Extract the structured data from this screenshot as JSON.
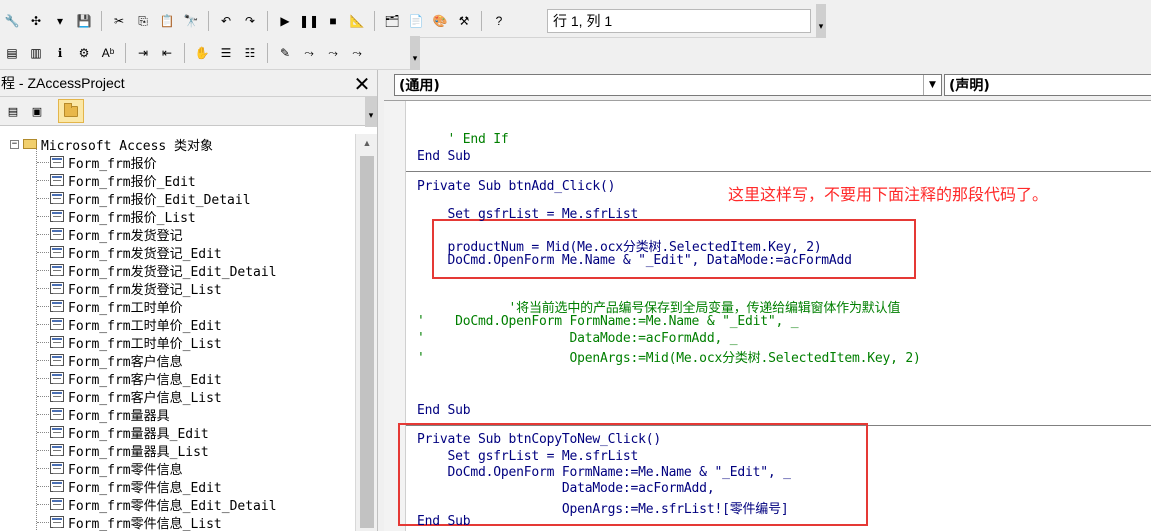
{
  "toolbar1": {
    "buttons": [
      {
        "icon": "tools-icon",
        "glyph": "🔧"
      },
      {
        "icon": "insert-icon",
        "glyph": "✣"
      },
      {
        "icon": "dropdown-arrow-icon",
        "glyph": "▾"
      },
      {
        "icon": "save-icon",
        "glyph": "💾"
      },
      {
        "icon": "cut-icon",
        "glyph": "✂"
      },
      {
        "icon": "copy-icon",
        "glyph": "⎘"
      },
      {
        "icon": "paste-icon",
        "glyph": "📋"
      },
      {
        "icon": "find-icon",
        "glyph": "🔭"
      },
      {
        "icon": "undo-icon",
        "glyph": "↶"
      },
      {
        "icon": "redo-icon",
        "glyph": "↷"
      },
      {
        "icon": "run-icon",
        "glyph": "▶"
      },
      {
        "icon": "break-icon",
        "glyph": "❚❚"
      },
      {
        "icon": "reset-icon",
        "glyph": "■"
      },
      {
        "icon": "design-mode-icon",
        "glyph": "📐"
      },
      {
        "icon": "project-explorer-icon",
        "glyph": "🗂"
      },
      {
        "icon": "properties-icon",
        "glyph": "📄"
      },
      {
        "icon": "object-browser-icon",
        "glyph": "🎨"
      },
      {
        "icon": "toolbox-icon",
        "glyph": "⚒"
      },
      {
        "icon": "help-icon",
        "glyph": "?"
      }
    ],
    "position_text": "行 1, 列 1"
  },
  "toolbar2": {
    "buttons": [
      {
        "icon": "list-properties-icon",
        "glyph": "▤"
      },
      {
        "icon": "list-constants-icon",
        "glyph": "▥"
      },
      {
        "icon": "quick-info-icon",
        "glyph": "ℹ"
      },
      {
        "icon": "parameter-info-icon",
        "glyph": "⚙"
      },
      {
        "icon": "complete-word-icon",
        "glyph": "Aᵇ"
      },
      {
        "icon": "indent-icon",
        "glyph": "⇥"
      },
      {
        "icon": "outdent-icon",
        "glyph": "⇤"
      },
      {
        "icon": "toggle-breakpoint-icon",
        "glyph": "✋"
      },
      {
        "icon": "comment-block-icon",
        "glyph": "☰"
      },
      {
        "icon": "uncomment-block-icon",
        "glyph": "☷"
      },
      {
        "icon": "toggle-bookmark-icon",
        "glyph": "✎"
      },
      {
        "icon": "next-bookmark-icon",
        "glyph": "⤳"
      },
      {
        "icon": "previous-bookmark-icon",
        "glyph": "⤳"
      },
      {
        "icon": "clear-bookmarks-icon",
        "glyph": "⤳"
      }
    ]
  },
  "project_panel": {
    "title": "程 - ZAccessProject",
    "close_glyph": "✕",
    "root_label": "Microsoft Access 类对象",
    "items": [
      "Form_frm报价",
      "Form_frm报价_Edit",
      "Form_frm报价_Edit_Detail",
      "Form_frm报价_List",
      "Form_frm发货登记",
      "Form_frm发货登记_Edit",
      "Form_frm发货登记_Edit_Detail",
      "Form_frm发货登记_List",
      "Form_frm工时单价",
      "Form_frm工时单价_Edit",
      "Form_frm工时单价_List",
      "Form_frm客户信息",
      "Form_frm客户信息_Edit",
      "Form_frm客户信息_List",
      "Form_frm量器具",
      "Form_frm量器具_Edit",
      "Form_frm量器具_List",
      "Form_frm零件信息",
      "Form_frm零件信息_Edit",
      "Form_frm零件信息_Edit_Detail",
      "Form_frm零件信息_List"
    ]
  },
  "code_window": {
    "object_combo": "(通用)",
    "procedure_combo": "(声明)",
    "annotation": "这里这样写，不要用下面注释的那段代码了。",
    "lines": [
      {
        "text": "    ' End If",
        "comment": true
      },
      {
        "text": "End Sub",
        "comment": false
      },
      {
        "text": "Private Sub btnAdd_Click()",
        "comment": false
      },
      {
        "text": "    Set gsfrList = Me.sfrList",
        "comment": false
      },
      {
        "text": "    productNum = Mid(Me.ocx分类树.SelectedItem.Key, 2)",
        "comment": false
      },
      {
        "text": "    DoCmd.OpenForm Me.Name & \"_Edit\", DataMode:=acFormAdd",
        "comment": false
      },
      {
        "text": "            '将当前选中的产品编号保存到全局变量，传递给编辑窗体作为默认值",
        "comment": true
      },
      {
        "text": "'    DoCmd.OpenForm FormName:=Me.Name & \"_Edit\", _",
        "comment": true
      },
      {
        "text": "'                   DataMode:=acFormAdd, _",
        "comment": true
      },
      {
        "text": "'                   OpenArgs:=Mid(Me.ocx分类树.SelectedItem.Key, 2)",
        "comment": true
      },
      {
        "text": "End Sub",
        "comment": false
      },
      {
        "text": "Private Sub btnCopyToNew_Click()",
        "comment": false
      },
      {
        "text": "    Set gsfrList = Me.sfrList",
        "comment": false
      },
      {
        "text": "    DoCmd.OpenForm FormName:=Me.Name & \"_Edit\", _",
        "comment": false
      },
      {
        "text": "                   DataMode:=acFormAdd,",
        "comment": false
      },
      {
        "text": "                   OpenArgs:=Me.sfrList![零件编号]",
        "comment": false
      },
      {
        "text": "End Sub",
        "comment": false
      }
    ]
  },
  "colors": {
    "keyword": "#00007f",
    "comment": "#007f00",
    "annotation": "#ff2a2a",
    "highlight_box": "#e53935"
  }
}
